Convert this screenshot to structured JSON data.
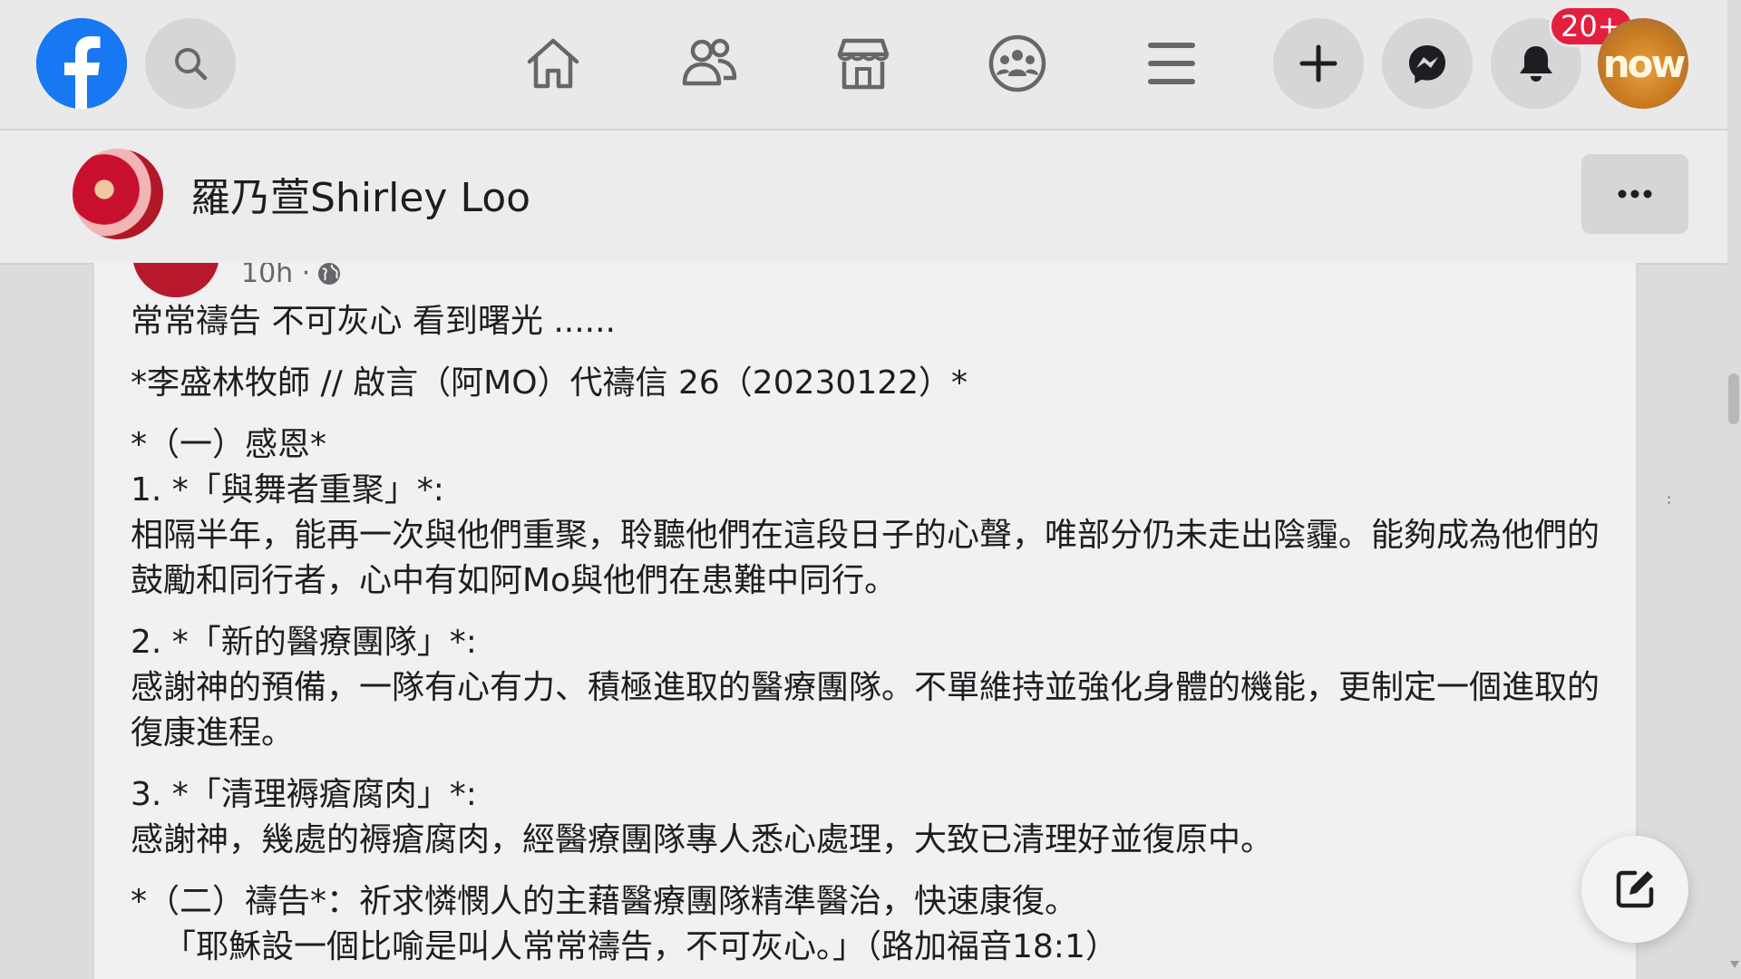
{
  "nav": {
    "notifications_badge": "20+",
    "profile_avatar_text": "now",
    "brand_color": "#1877f2",
    "badge_color": "#e41e3f",
    "icons": [
      "facebook-logo",
      "search-icon",
      "home-icon",
      "friends-icon",
      "marketplace-icon",
      "groups-icon",
      "menu-icon",
      "plus-icon",
      "messenger-icon",
      "bell-icon"
    ]
  },
  "profile_header": {
    "name": "羅乃萱Shirley Loo",
    "more_label": "···"
  },
  "post": {
    "time": "10h ·",
    "lines": {
      "l1": "常常禱告 不可灰心 看到曙光 ......",
      "l2": "*李盛林牧師 // 啟言（阿MO）代禱信 26（20230122）*",
      "l3": "*（一）感恩*",
      "l4": "1. *「與舞者重聚」*:",
      "l5": "相隔半年，能再一次與他們重聚，聆聽他們在這段日子的心聲，唯部分仍未走出陰霾。能夠成為他們的鼓勵和同行者，心中有如阿Mo與他們在患難中同行。",
      "l6": "2. *「新的醫療團隊」*:",
      "l7": "感謝神的預備，一隊有心有力、積極進取的醫療團隊。不單維持並強化身體的機能，更制定一個進取的復康進程。",
      "l8": "3. *「清理褥瘡腐肉」*:",
      "l9": "感謝神，幾處的褥瘡腐肉，經醫療團隊專人悉心處理，大致已清理好並復原中。",
      "l10": "*（二）禱告*：祈求憐憫人的主藉醫療團隊精準醫治，快速康復。",
      "l11": "「耶穌設一個比喻是叫人常常禱告，不可灰心。」（路加福音18:1）"
    }
  }
}
